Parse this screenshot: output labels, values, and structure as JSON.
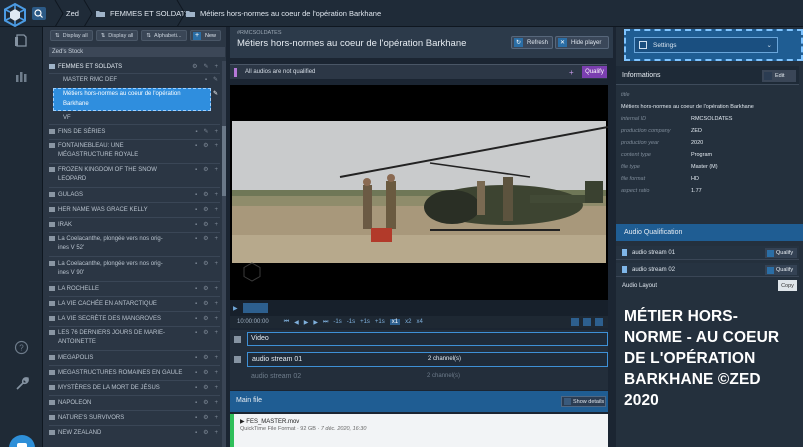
{
  "breadcrumb": {
    "root": "Zed",
    "folder": "FEMMES ET SOLDATS",
    "item": "Métiers hors-normes au coeur de l'opération Barkhane"
  },
  "tree": {
    "toolbar": {
      "display_all_1": "Display all",
      "display_all_2": "Display all",
      "alphabetical": "Alphabeti...",
      "new_label": "New"
    },
    "filter": "Zed's Stock",
    "items": [
      {
        "label": "FEMMES ET SOLDATS"
      },
      {
        "label": "MASTER RMC DEF"
      },
      {
        "label_line1": "Métiers hors-normes au coeur de l'opération",
        "label_line2": "Barkhane"
      },
      {
        "label": "VF"
      },
      {
        "label": "FINS DE SÉRIES"
      },
      {
        "label_line1": "FONTAINEBLEAU: UNE",
        "label_line2": "MÉGASTRUCTURE ROYALE"
      },
      {
        "label_line1": "FROZEN KINGDOM OF THE SNOW",
        "label_line2": "LEOPARD"
      },
      {
        "label": "GULAGS"
      },
      {
        "label": "HER NAME WAS GRACE KELLY"
      },
      {
        "label": "IRAK"
      },
      {
        "label_line1": "La Coelacanthe, plongée vers nos orig-",
        "label_line2": "ines V 52'"
      },
      {
        "label_line1": "La Coelacanthe, plongée vers nos orig-",
        "label_line2": "ines V 90'"
      },
      {
        "label": "LA ROCHELLE"
      },
      {
        "label": "LA VIE CACHÉE EN ANTARCTIQUE"
      },
      {
        "label": "LA VIE SECRÈTE DES MANGROVES"
      },
      {
        "label_line1": "LES 76 DERNIERS JOURS DE MARIE-",
        "label_line2": "ANTOINETTE"
      },
      {
        "label": "MEGAPOLIS"
      },
      {
        "label": "MEGASTRUCTURES ROMAINES EN GAULE"
      },
      {
        "label": "MYSTÈRES DE LA MORT DE JÉSUS"
      },
      {
        "label": "NAPOLEON"
      },
      {
        "label": "NATURE'S SURVIVORS"
      },
      {
        "label": "NEW ZEALAND"
      }
    ]
  },
  "header": {
    "subtitle": "#RMCSOLDATES",
    "title": "Métiers hors-normes au coeur de l'opération Barkhane",
    "refresh": "Refresh",
    "hide_player": "Hide player"
  },
  "qualify_bar": {
    "text": "All audios are not qualified",
    "button": "Qualify"
  },
  "player": {
    "timecode": "10:00:00:00",
    "controls": [
      "-1s",
      "-1s",
      "+1s",
      "+1s",
      "x1",
      "x2",
      "x4"
    ]
  },
  "tracks": {
    "video": "Video",
    "audio": [
      {
        "name": "audio stream 01",
        "channels": "2 channel(s)"
      },
      {
        "name": "audio stream 02",
        "channels": "2 channel(s)"
      }
    ]
  },
  "main_file": {
    "title": "Main file",
    "show_details": "Show details",
    "file_name": "FES_MASTER.mov",
    "file_desc": "QuickTime File Format · 92 GB",
    "file_date": "7 déc. 2020, 16:30"
  },
  "settings": {
    "label": "Settings"
  },
  "informations": {
    "title": "Informations",
    "edit": "Edit",
    "title_key": "title",
    "title_value": "Métiers hors-normes au coeur de l'opération Barkhane",
    "rows": [
      {
        "key": "internal ID",
        "value": "RMCSOLDATES"
      },
      {
        "key": "production company",
        "value": "ZED"
      },
      {
        "key": "production year",
        "value": "2020"
      },
      {
        "key": "content type",
        "value": "Program"
      },
      {
        "key": "file type",
        "value": "Master (M)"
      },
      {
        "key": "file format",
        "value": "HD"
      },
      {
        "key": "aspect ratio",
        "value": "1.77"
      }
    ]
  },
  "audio_qualification": {
    "title": "Audio Qualification",
    "rows": [
      {
        "name": "audio stream 01",
        "button": "Qualify"
      },
      {
        "name": "audio stream 02",
        "button": "Qualify"
      }
    ],
    "layout_label": "Audio Layout",
    "copy": "Copy"
  },
  "caption": "MÉTIER HORS-NORME - AU COEUR DE L'OPÉRATION BARKHANE ©ZED 2020",
  "colors": {
    "accent_blue": "#1f5d93",
    "selected_blue": "#2f8ede",
    "qualify_purple": "#7b3fb0",
    "file_green": "#2fbf5a"
  }
}
